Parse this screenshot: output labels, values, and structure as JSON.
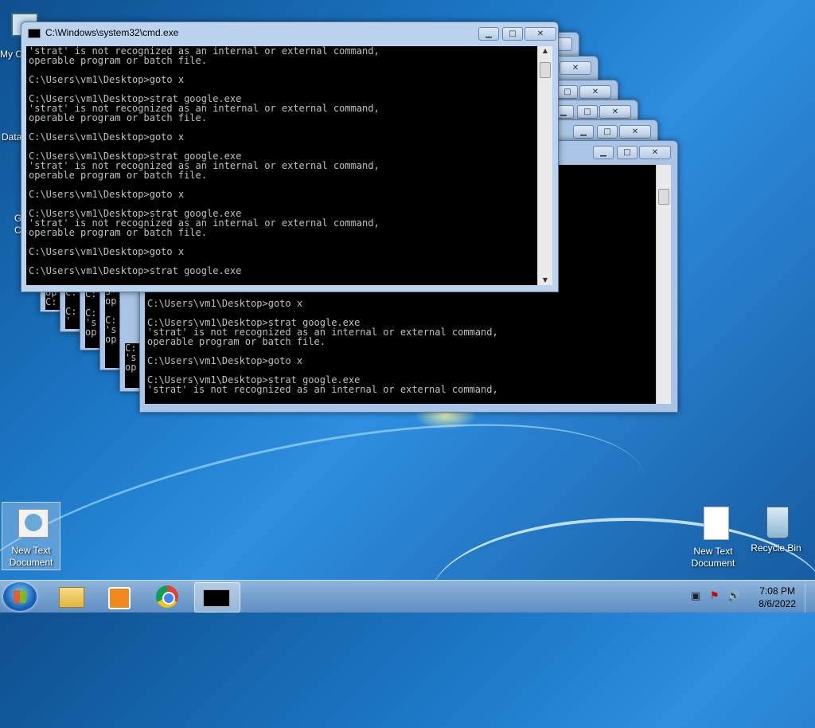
{
  "desktop": {
    "left_icons": [
      {
        "label": "My C"
      },
      {
        "label": "Data"
      },
      {
        "label": "G\nC"
      }
    ],
    "new_text_document_left": "New Text\nDocument",
    "new_text_document_right": "New Text\nDocument",
    "recycle_bin": "Recycle Bin"
  },
  "front_window": {
    "title": "C:\\Windows\\system32\\cmd.exe",
    "console_text": "'strat' is not recognized as an internal or external command,\noperable program or batch file.\n\nC:\\Users\\vm1\\Desktop>goto x\n\nC:\\Users\\vm1\\Desktop>strat google.exe\n'strat' is not recognized as an internal or external command,\noperable program or batch file.\n\nC:\\Users\\vm1\\Desktop>goto x\n\nC:\\Users\\vm1\\Desktop>strat google.exe\n'strat' is not recognized as an internal or external command,\noperable program or batch file.\n\nC:\\Users\\vm1\\Desktop>goto x\n\nC:\\Users\\vm1\\Desktop>strat google.exe\n'strat' is not recognized as an internal or external command,\noperable program or batch file.\n\nC:\\Users\\vm1\\Desktop>goto x\n\nC:\\Users\\vm1\\Desktop>strat google.exe"
  },
  "back_window": {
    "console_text": "C:\\Users\\vm1\\Desktop>goto x\n\nC:\\Users\\vm1\\Desktop>strat google.exe\n'strat' is not recognized as an internal or external command,\noperable program or batch file.\n\nC:\\Users\\vm1\\Desktop>goto x\n\nC:\\Users\\vm1\\Desktop>strat google.exe\n'strat' is not recognized as an internal or external command,"
  },
  "stacked_fragments": [
    "op\nC:\n\nC:",
    "C:\n\nC:\n'",
    "C:\n\nC:\n's\nop",
    "s\nop\n\nC:\n's\nop",
    "C:\n's\nop"
  ],
  "window_controls": {
    "minimize": "▁",
    "maximize": "□",
    "close": "✕"
  },
  "taskbar": {
    "time": "7:08 PM",
    "date": "8/6/2022"
  },
  "colors": {
    "console_bg": "#000000",
    "console_fg": "#c0c0c0",
    "window_frame": "#a9c4e4",
    "taskbar": "#6f9ccb"
  }
}
